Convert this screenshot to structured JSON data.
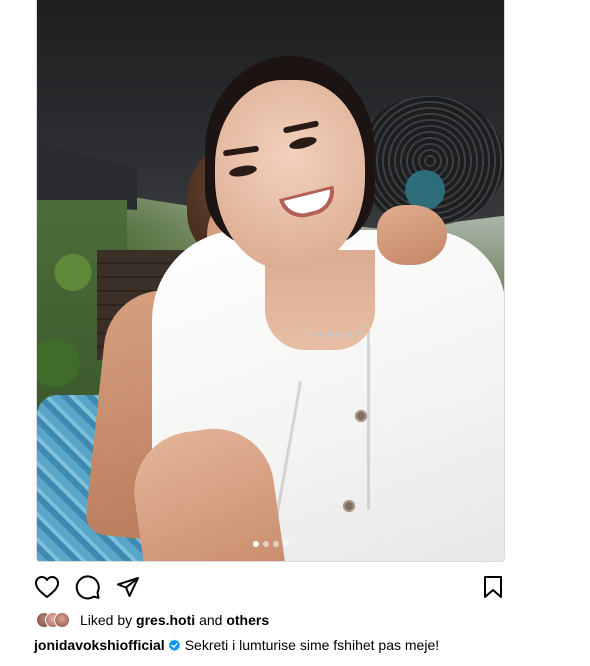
{
  "post": {
    "image": {
      "carousel_dot_count": 4,
      "active_dot_index": 0
    },
    "actions": {
      "like_icon": "heart-icon",
      "comment_icon": "comment-icon",
      "share_icon": "send-icon",
      "save_icon": "bookmark-icon"
    },
    "likes": {
      "prefix": "Liked by",
      "user": "gres.hoti",
      "connector": "and",
      "suffix": "others"
    },
    "caption": {
      "username": "jonidavokshiofficial",
      "verified": true,
      "text": "Sekreti i lumturise sime fshihet pas meje!"
    }
  },
  "colors": {
    "verified_badge": "#0095f6",
    "text_primary": "#000000",
    "text_secondary": "#737373"
  }
}
